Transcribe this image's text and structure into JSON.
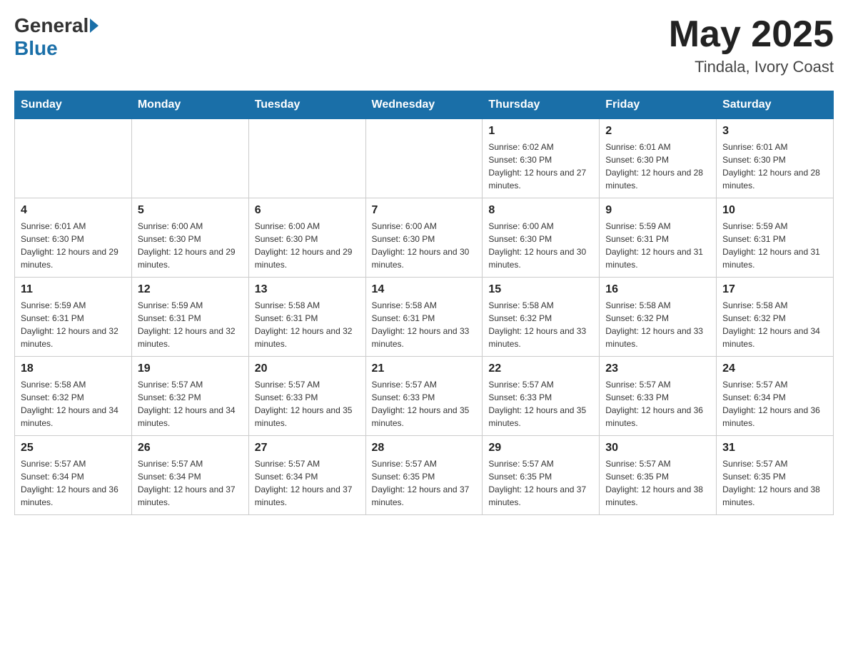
{
  "header": {
    "logo_general": "General",
    "logo_blue": "Blue",
    "month_title": "May 2025",
    "location": "Tindala, Ivory Coast"
  },
  "days_of_week": [
    "Sunday",
    "Monday",
    "Tuesday",
    "Wednesday",
    "Thursday",
    "Friday",
    "Saturday"
  ],
  "weeks": [
    [
      {
        "day": "",
        "info": ""
      },
      {
        "day": "",
        "info": ""
      },
      {
        "day": "",
        "info": ""
      },
      {
        "day": "",
        "info": ""
      },
      {
        "day": "1",
        "info": "Sunrise: 6:02 AM\nSunset: 6:30 PM\nDaylight: 12 hours and 27 minutes."
      },
      {
        "day": "2",
        "info": "Sunrise: 6:01 AM\nSunset: 6:30 PM\nDaylight: 12 hours and 28 minutes."
      },
      {
        "day": "3",
        "info": "Sunrise: 6:01 AM\nSunset: 6:30 PM\nDaylight: 12 hours and 28 minutes."
      }
    ],
    [
      {
        "day": "4",
        "info": "Sunrise: 6:01 AM\nSunset: 6:30 PM\nDaylight: 12 hours and 29 minutes."
      },
      {
        "day": "5",
        "info": "Sunrise: 6:00 AM\nSunset: 6:30 PM\nDaylight: 12 hours and 29 minutes."
      },
      {
        "day": "6",
        "info": "Sunrise: 6:00 AM\nSunset: 6:30 PM\nDaylight: 12 hours and 29 minutes."
      },
      {
        "day": "7",
        "info": "Sunrise: 6:00 AM\nSunset: 6:30 PM\nDaylight: 12 hours and 30 minutes."
      },
      {
        "day": "8",
        "info": "Sunrise: 6:00 AM\nSunset: 6:30 PM\nDaylight: 12 hours and 30 minutes."
      },
      {
        "day": "9",
        "info": "Sunrise: 5:59 AM\nSunset: 6:31 PM\nDaylight: 12 hours and 31 minutes."
      },
      {
        "day": "10",
        "info": "Sunrise: 5:59 AM\nSunset: 6:31 PM\nDaylight: 12 hours and 31 minutes."
      }
    ],
    [
      {
        "day": "11",
        "info": "Sunrise: 5:59 AM\nSunset: 6:31 PM\nDaylight: 12 hours and 32 minutes."
      },
      {
        "day": "12",
        "info": "Sunrise: 5:59 AM\nSunset: 6:31 PM\nDaylight: 12 hours and 32 minutes."
      },
      {
        "day": "13",
        "info": "Sunrise: 5:58 AM\nSunset: 6:31 PM\nDaylight: 12 hours and 32 minutes."
      },
      {
        "day": "14",
        "info": "Sunrise: 5:58 AM\nSunset: 6:31 PM\nDaylight: 12 hours and 33 minutes."
      },
      {
        "day": "15",
        "info": "Sunrise: 5:58 AM\nSunset: 6:32 PM\nDaylight: 12 hours and 33 minutes."
      },
      {
        "day": "16",
        "info": "Sunrise: 5:58 AM\nSunset: 6:32 PM\nDaylight: 12 hours and 33 minutes."
      },
      {
        "day": "17",
        "info": "Sunrise: 5:58 AM\nSunset: 6:32 PM\nDaylight: 12 hours and 34 minutes."
      }
    ],
    [
      {
        "day": "18",
        "info": "Sunrise: 5:58 AM\nSunset: 6:32 PM\nDaylight: 12 hours and 34 minutes."
      },
      {
        "day": "19",
        "info": "Sunrise: 5:57 AM\nSunset: 6:32 PM\nDaylight: 12 hours and 34 minutes."
      },
      {
        "day": "20",
        "info": "Sunrise: 5:57 AM\nSunset: 6:33 PM\nDaylight: 12 hours and 35 minutes."
      },
      {
        "day": "21",
        "info": "Sunrise: 5:57 AM\nSunset: 6:33 PM\nDaylight: 12 hours and 35 minutes."
      },
      {
        "day": "22",
        "info": "Sunrise: 5:57 AM\nSunset: 6:33 PM\nDaylight: 12 hours and 35 minutes."
      },
      {
        "day": "23",
        "info": "Sunrise: 5:57 AM\nSunset: 6:33 PM\nDaylight: 12 hours and 36 minutes."
      },
      {
        "day": "24",
        "info": "Sunrise: 5:57 AM\nSunset: 6:34 PM\nDaylight: 12 hours and 36 minutes."
      }
    ],
    [
      {
        "day": "25",
        "info": "Sunrise: 5:57 AM\nSunset: 6:34 PM\nDaylight: 12 hours and 36 minutes."
      },
      {
        "day": "26",
        "info": "Sunrise: 5:57 AM\nSunset: 6:34 PM\nDaylight: 12 hours and 37 minutes."
      },
      {
        "day": "27",
        "info": "Sunrise: 5:57 AM\nSunset: 6:34 PM\nDaylight: 12 hours and 37 minutes."
      },
      {
        "day": "28",
        "info": "Sunrise: 5:57 AM\nSunset: 6:35 PM\nDaylight: 12 hours and 37 minutes."
      },
      {
        "day": "29",
        "info": "Sunrise: 5:57 AM\nSunset: 6:35 PM\nDaylight: 12 hours and 37 minutes."
      },
      {
        "day": "30",
        "info": "Sunrise: 5:57 AM\nSunset: 6:35 PM\nDaylight: 12 hours and 38 minutes."
      },
      {
        "day": "31",
        "info": "Sunrise: 5:57 AM\nSunset: 6:35 PM\nDaylight: 12 hours and 38 minutes."
      }
    ]
  ]
}
